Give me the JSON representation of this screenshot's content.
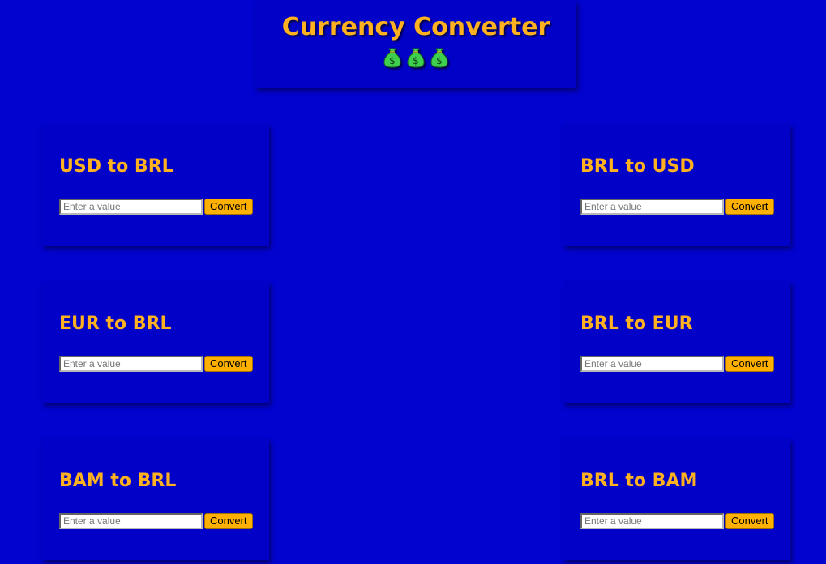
{
  "header": {
    "title": "Currency Converter"
  },
  "colors": {
    "background": "#0303cf",
    "panel": "#0101c8",
    "accent": "#ffb11f",
    "button": "#ffb000"
  },
  "icons": [
    "money-bag-icon",
    "money-bag-icon",
    "money-bag-icon"
  ],
  "cards": [
    {
      "title": "USD to BRL",
      "placeholder": "Enter a value",
      "button": "Convert"
    },
    {
      "title": "BRL to USD",
      "placeholder": "Enter a value",
      "button": "Convert"
    },
    {
      "title": "EUR to BRL",
      "placeholder": "Enter a value",
      "button": "Convert"
    },
    {
      "title": "BRL to EUR",
      "placeholder": "Enter a value",
      "button": "Convert"
    },
    {
      "title": "BAM to BRL",
      "placeholder": "Enter a value",
      "button": "Convert"
    },
    {
      "title": "BRL to BAM",
      "placeholder": "Enter a value",
      "button": "Convert"
    }
  ]
}
